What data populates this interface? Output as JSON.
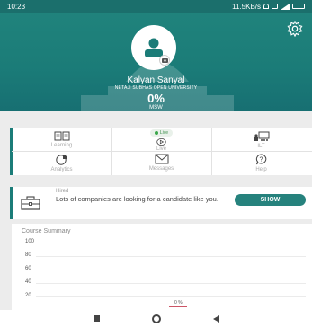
{
  "status_bar": {
    "time": "10:23",
    "net": "11.5KB/s"
  },
  "profile": {
    "name": "Kalyan Sanyal",
    "university": "NETAJI SUBHAS OPEN UNIVERSITY",
    "progress": "0%",
    "program": "MSW"
  },
  "tiles": [
    {
      "label": "Learning",
      "icon": "book-icon"
    },
    {
      "label": "Live",
      "badge": "Live",
      "icon": "play-icon"
    },
    {
      "label": "ILT",
      "icon": "classroom-icon"
    },
    {
      "label": "Analytics",
      "icon": "pie-chart-icon"
    },
    {
      "label": "Messages",
      "icon": "envelope-icon"
    },
    {
      "label": "Help",
      "icon": "help-bubble-icon"
    }
  ],
  "hired_card": {
    "title": "Hired",
    "text": "Lots of companies are looking for a candidate like you.",
    "button": "SHOW"
  },
  "course_summary": {
    "title": "Course Summary",
    "y_ticks": [
      "100",
      "80",
      "60",
      "40",
      "20"
    ],
    "bar_label": "0 %"
  },
  "chart_data": {
    "type": "bar",
    "title": "Course Summary",
    "categories": [
      ""
    ],
    "values": [
      0
    ],
    "data_labels": [
      "0 %"
    ],
    "ylim": [
      0,
      100
    ],
    "y_ticks": [
      20,
      40,
      60,
      80,
      100
    ]
  },
  "colors": {
    "brand": "#1b7c78",
    "button": "#26827d",
    "live": "#3aa74a"
  }
}
